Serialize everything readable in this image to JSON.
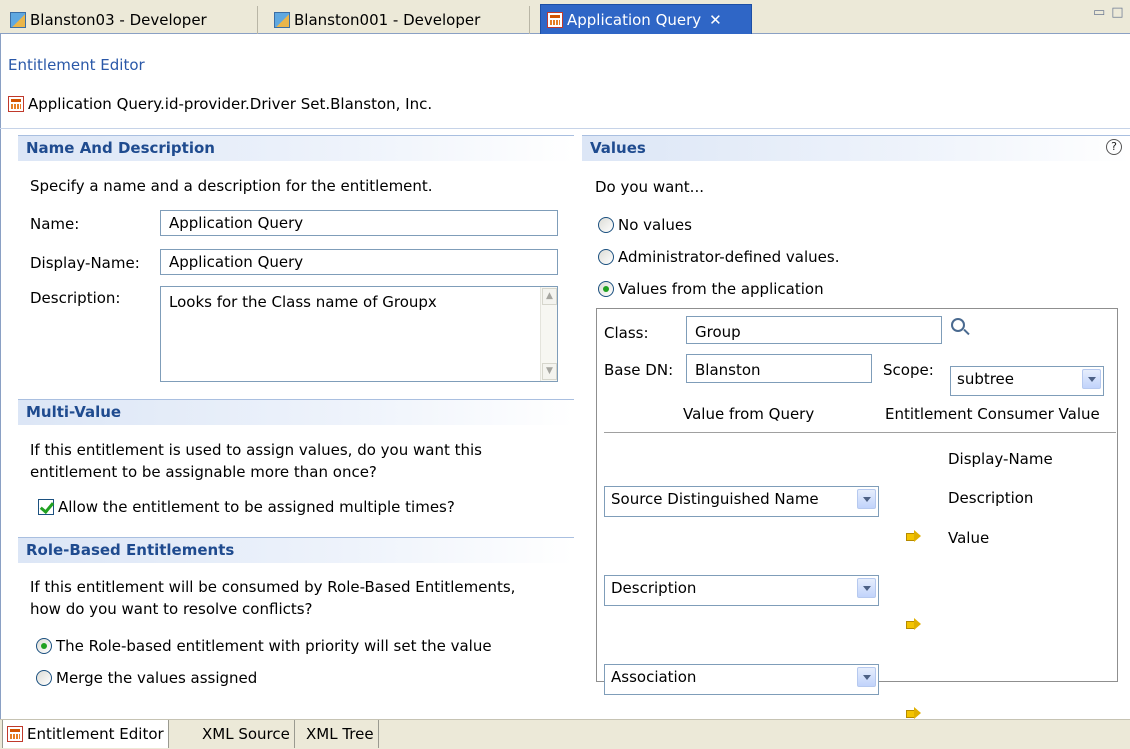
{
  "tabs": [
    {
      "label": "Blanston03 - Developer",
      "icon": "developer-icon"
    },
    {
      "label": "Blanston001 - Developer",
      "icon": "developer-icon"
    },
    {
      "label": "Application Query",
      "icon": "entitlement-icon",
      "active": true,
      "close": "✕"
    }
  ],
  "window_controls": {
    "minimize": "▭",
    "maximize": "□"
  },
  "editor": {
    "title": "Entitlement Editor",
    "path": "Application Query.id-provider.Driver Set.Blanston, Inc."
  },
  "name_section": {
    "header": "Name And Description",
    "intro": "Specify a name and a description for the entitlement.",
    "name_label": "Name:",
    "name_value": "Application Query",
    "display_label": "Display-Name:",
    "display_value": "Application Query",
    "description_label": "Description:",
    "description_value": "Looks for the Class name of Groupx"
  },
  "multi_value": {
    "header": "Multi-Value",
    "question_line1": "If this entitlement is used to assign values, do you want this",
    "question_line2": "entitlement to be assignable more than once?",
    "checkbox_label": "Allow the entitlement to be assigned multiple times?",
    "checked": true
  },
  "role_based": {
    "header": "Role-Based Entitlements",
    "question_line1": "If this entitlement will be consumed by Role-Based Entitlements,",
    "question_line2": "how do you want to resolve conflicts?",
    "option1": "The Role-based entitlement with priority will set the value",
    "option2": "Merge the values assigned",
    "selected": 1
  },
  "values": {
    "header": "Values",
    "help_icon": "?",
    "prompt": "Do you want...",
    "option_none": "No values",
    "option_admin": "Administrator-defined values.",
    "option_app": "Values from the application",
    "selected": "app",
    "class_label": "Class:",
    "class_value": "Group",
    "base_dn_label": "Base DN:",
    "base_dn_value": "Blanston",
    "scope_label": "Scope:",
    "scope_value": "subtree",
    "col_query": "Value from Query",
    "col_consumer": "Entitlement Consumer Value",
    "mappings": [
      {
        "query": "Source Distinguished Name",
        "consumer": "Display-Name"
      },
      {
        "query": "Description",
        "consumer": "Description"
      },
      {
        "query": "Association",
        "consumer": "Value"
      }
    ]
  },
  "bottom_tabs": [
    {
      "label": "Entitlement Editor",
      "active": true
    },
    {
      "label": "XML Source"
    },
    {
      "label": "XML Tree"
    }
  ]
}
